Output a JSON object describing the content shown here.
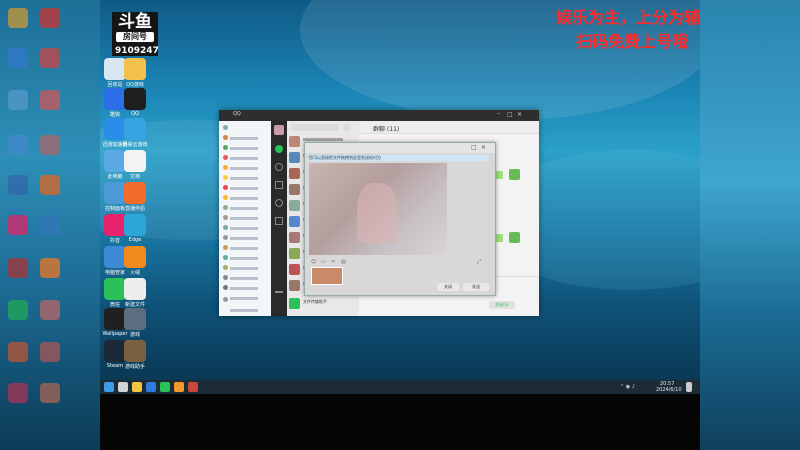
{
  "stream": {
    "logo_text": "斗鱼",
    "logo_sub": "房间号",
    "room_number": "9109247",
    "promo_line1": "娱乐为主，上分为辅",
    "promo_line2": "扫码免费上号哦"
  },
  "desktop_icons": [
    {
      "label": "回收站",
      "icon": "recycle-bin-icon",
      "color": "#d8e6f2"
    },
    {
      "label": "QQ游戏",
      "icon": "qq-game-icon",
      "color": "#f2c14a"
    },
    {
      "label": "酷狗",
      "icon": "kugou-icon",
      "color": "#2c6fe8"
    },
    {
      "label": "QQ",
      "icon": "qq-penguin-icon",
      "color": "#1f1f1f"
    },
    {
      "label": "迅游加速器",
      "icon": "booster-icon",
      "color": "#2a8ee8"
    },
    {
      "label": "网易云游戏",
      "icon": "cloud-game-icon",
      "color": "#35a4e0"
    },
    {
      "label": "此电脑",
      "icon": "computer-icon",
      "color": "#5aa9e6"
    },
    {
      "label": "文档",
      "icon": "document-icon",
      "color": "#f3f3f3"
    },
    {
      "label": "控制面板",
      "icon": "control-panel-icon",
      "color": "#4a9bd8"
    },
    {
      "label": "直播伴侣",
      "icon": "live-companion-icon",
      "color": "#f26b2a"
    },
    {
      "label": "抖音",
      "icon": "douyin-icon",
      "color": "#e8236b"
    },
    {
      "label": "Edge",
      "icon": "edge-icon",
      "color": "#2aa7d8"
    },
    {
      "label": "电脑管家",
      "icon": "pc-manager-icon",
      "color": "#3e8ad6"
    },
    {
      "label": "火绒",
      "icon": "huorong-icon",
      "color": "#f28a1e"
    },
    {
      "label": "微信",
      "icon": "wechat-icon",
      "color": "#2bc158"
    },
    {
      "label": "新建文件",
      "icon": "file-icon",
      "color": "#eeeeee"
    },
    {
      "label": "Wallpaper",
      "icon": "wallpaper-icon",
      "color": "#202020"
    },
    {
      "label": "游戏",
      "icon": "game-icon",
      "color": "#5a6e80"
    },
    {
      "label": "Steam",
      "icon": "steam-icon",
      "color": "#1b2838"
    },
    {
      "label": "游戏助手",
      "icon": "helper-icon",
      "color": "#7a6040"
    }
  ],
  "window": {
    "title": "QQ",
    "list_header": "群聊 (11)",
    "notice_text": "您可以直接把文件拖拽到这里发送给对方",
    "btn_close": "关闭(C)",
    "btn_send": "发送(S)",
    "popup_btn_left": "关闭",
    "popup_btn_right": "发送",
    "bottom_label": "文件传输助手"
  },
  "taskbar": {
    "time": "20:57",
    "date": "2024/6/10",
    "apps": [
      "start-icon",
      "search-icon",
      "explorer-icon",
      "qq-icon",
      "wechat-icon",
      "folder-icon",
      "media-icon"
    ]
  },
  "colors": {
    "promo": "#ff2a2a",
    "wechat_green": "#2bc158",
    "taskbar": "#1c2b36"
  }
}
